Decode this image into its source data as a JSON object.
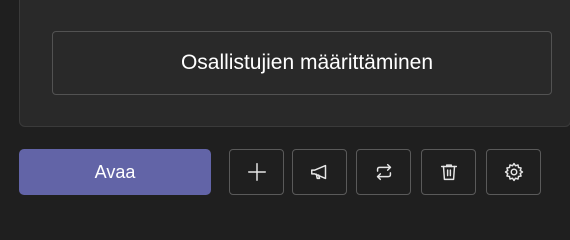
{
  "panel": {
    "option_label": "Osallistujien määrittäminen"
  },
  "toolbar": {
    "open_label": "Avaa",
    "icons": [
      "plus-icon",
      "megaphone-icon",
      "sync-icon",
      "trash-icon",
      "gear-icon"
    ]
  },
  "colors": {
    "background": "#1f1f1f",
    "card": "#292929",
    "accent": "#6264a7",
    "border": "#5a5a5a",
    "text": "#ffffff"
  }
}
